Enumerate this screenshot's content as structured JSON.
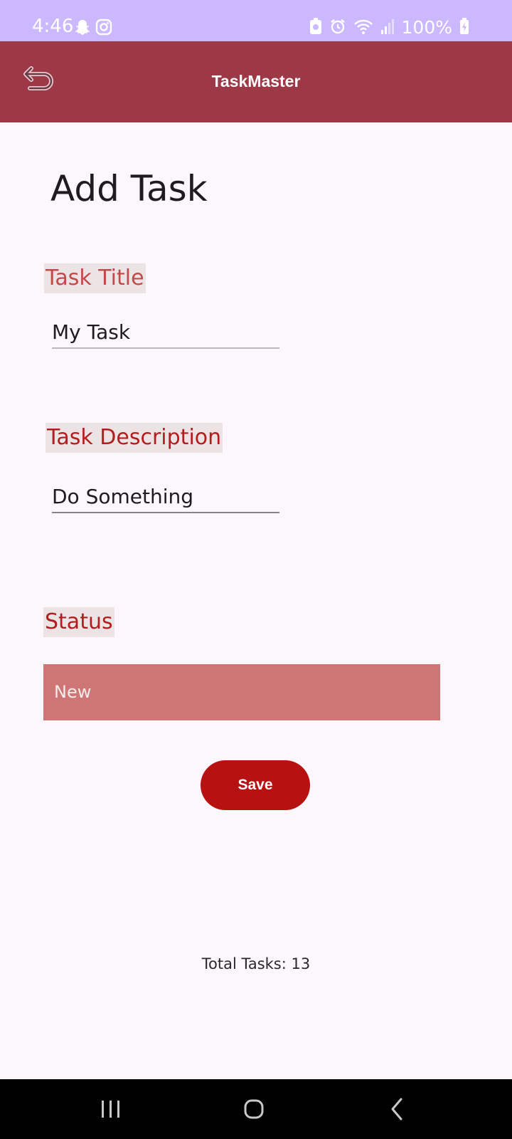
{
  "status_bar": {
    "time": "4:46",
    "battery": "100%",
    "left_icons": [
      "snapchat-icon",
      "instagram-icon"
    ],
    "right_icons": [
      "notification-icon",
      "alarm-icon",
      "wifi-icon",
      "signal-icon",
      "battery-charging-icon"
    ]
  },
  "app_bar": {
    "title": "TaskMaster",
    "back_icon": "back-arrow-icon",
    "color": "#9d3846"
  },
  "page": {
    "title": "Add Task"
  },
  "form": {
    "title_label": "Task Title",
    "title_value": "My Task",
    "description_label": "Task Description",
    "description_value": "Do Something",
    "status_label": "Status",
    "status_value": "New",
    "save_label": "Save"
  },
  "footer": {
    "total_tasks": "Total Tasks: 13"
  },
  "nav_bar": {
    "buttons": [
      "recents-icon",
      "home-icon",
      "back-icon"
    ]
  },
  "colors": {
    "status_bar": "#cbb8ff",
    "accent": "#b81112",
    "select_bg": "#cd7675",
    "background": "#fcf7fb"
  }
}
